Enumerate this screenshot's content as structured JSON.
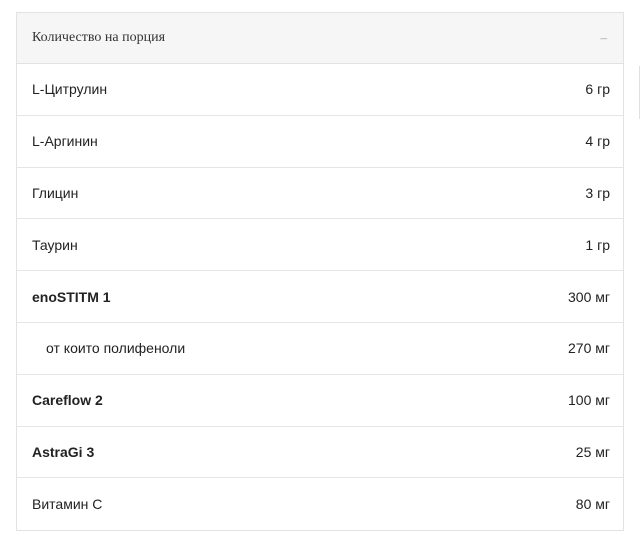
{
  "header": {
    "title": "Количество на порция",
    "toggle": "–"
  },
  "rows": [
    {
      "name": "L-Цитрулин",
      "amount": "6 гр"
    },
    {
      "name": "L-Аргинин",
      "amount": "4 гр"
    },
    {
      "name": "Глицин",
      "amount": "3 гр"
    },
    {
      "name": "Таурин",
      "amount": "1 гр"
    },
    {
      "name": "enoSTITM 1",
      "amount": "300 мг"
    },
    {
      "name": "от които полифеноли",
      "amount": "270 мг"
    },
    {
      "name": "Careflow 2",
      "amount": "100 мг"
    },
    {
      "name": "AstraGi 3",
      "amount": "25 мг"
    },
    {
      "name": "Витамин С",
      "amount": "80 мг"
    }
  ]
}
